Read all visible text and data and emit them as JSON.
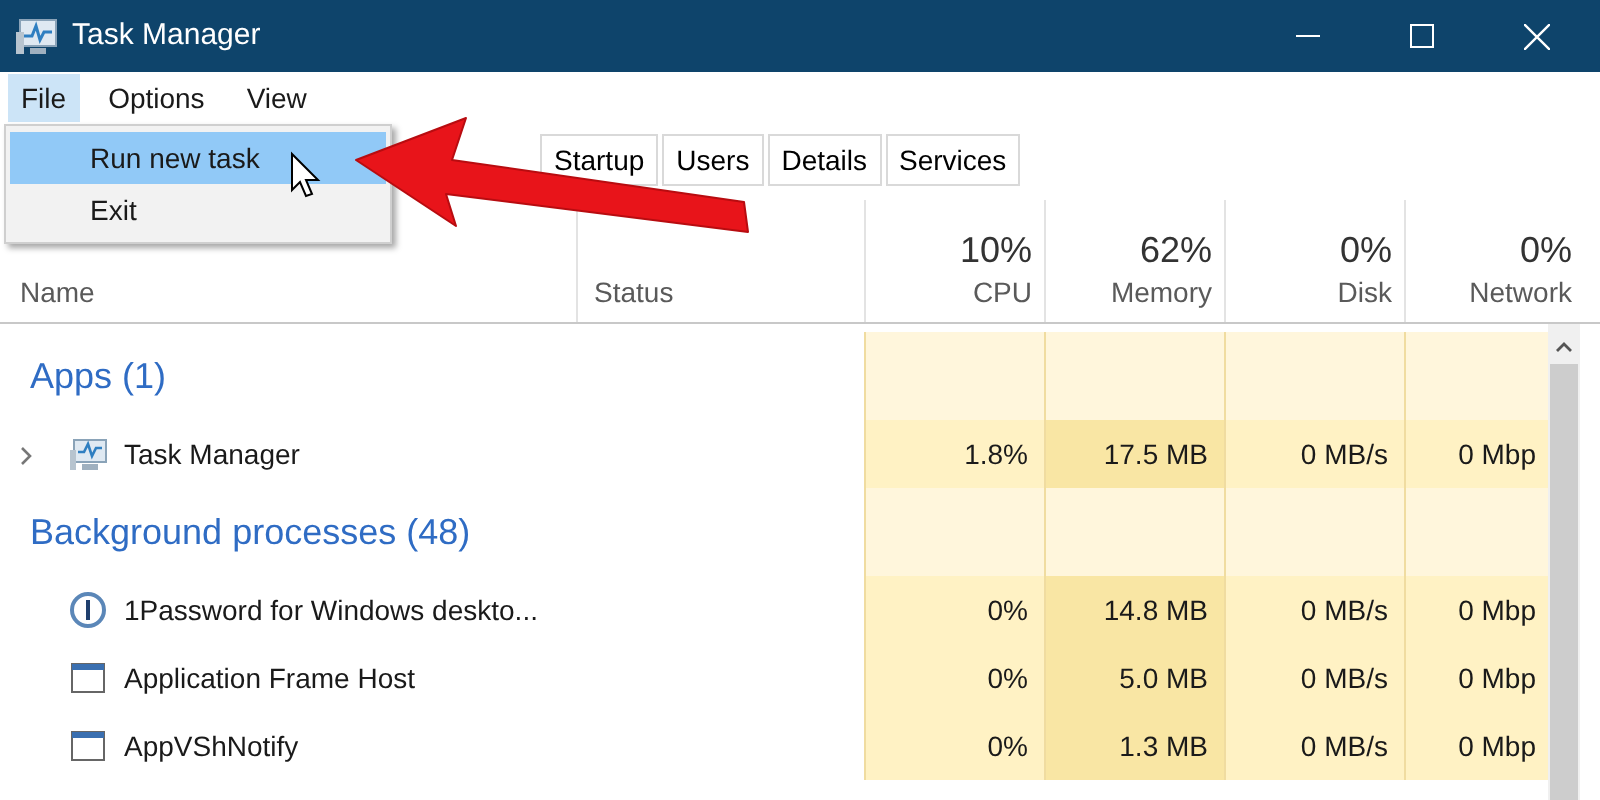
{
  "window": {
    "title": "Task Manager"
  },
  "menu_bar": [
    {
      "label": "File",
      "selected": true
    },
    {
      "label": "Options",
      "selected": false
    },
    {
      "label": "View",
      "selected": false
    }
  ],
  "file_menu": [
    {
      "label": "Run new task",
      "selected": true
    },
    {
      "label": "Exit",
      "selected": false
    }
  ],
  "tabs": [
    {
      "label": "Startup"
    },
    {
      "label": "Users"
    },
    {
      "label": "Details"
    },
    {
      "label": "Services"
    }
  ],
  "columns": [
    {
      "label": "Name"
    },
    {
      "label": "Status"
    },
    {
      "usage": "10%",
      "label": "CPU"
    },
    {
      "usage": "62%",
      "label": "Memory"
    },
    {
      "usage": "0%",
      "label": "Disk"
    },
    {
      "usage": "0%",
      "label": "Network"
    }
  ],
  "groups": [
    {
      "title": "Apps (1)",
      "rows": [
        {
          "name": "Task Manager",
          "expandable": true,
          "kind": "monitor",
          "cpu": "1.8%",
          "memory": "17.5 MB",
          "disk": "0 MB/s",
          "network": "0 Mbp"
        }
      ]
    },
    {
      "title": "Background processes (48)",
      "rows": [
        {
          "name": "1Password for Windows deskto...",
          "expandable": false,
          "kind": "ring",
          "cpu": "0%",
          "memory": "14.8 MB",
          "disk": "0 MB/s",
          "network": "0 Mbp"
        },
        {
          "name": "Application Frame Host",
          "expandable": false,
          "kind": "window",
          "cpu": "0%",
          "memory": "5.0 MB",
          "disk": "0 MB/s",
          "network": "0 Mbp"
        },
        {
          "name": "AppVShNotify",
          "expandable": false,
          "kind": "window",
          "cpu": "0%",
          "memory": "1.3 MB",
          "disk": "0 MB/s",
          "network": "0 Mbp"
        }
      ]
    }
  ]
}
